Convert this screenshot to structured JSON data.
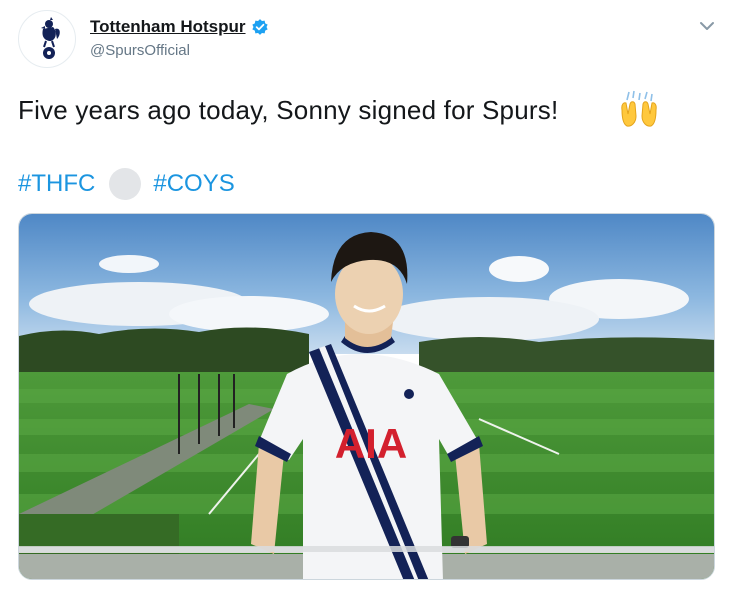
{
  "tweet": {
    "display_name": "Tottenham Hotspur",
    "handle": "@SpursOfficial",
    "text": "Five years ago today, Sonny signed for Spurs!",
    "emoji_icon": "raising-hands-icon",
    "hashtags": [
      "#THFC",
      "#COYS"
    ],
    "inline_emoji_icon": "football-icon",
    "media": {
      "icon": "photo",
      "shirt_sponsor": "AIA"
    }
  },
  "colors": {
    "link": "#1b95e0",
    "verified": "#1da1f2",
    "text": "#14171a",
    "secondary_text": "#657786",
    "spurs_navy": "#132257"
  }
}
